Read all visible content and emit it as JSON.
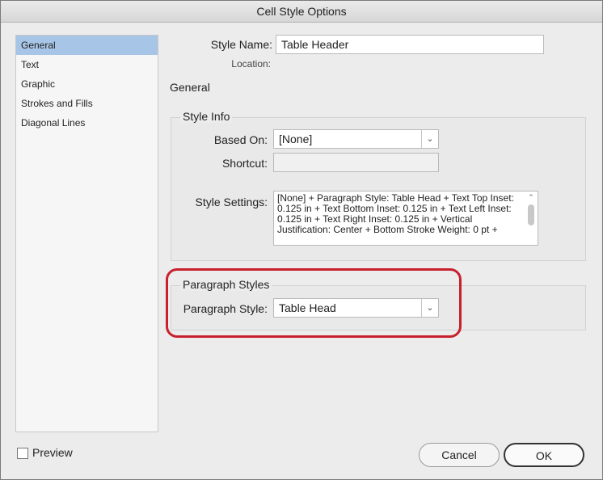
{
  "window": {
    "title": "Cell Style Options"
  },
  "sidebar": {
    "items": [
      {
        "label": "General",
        "selected": true
      },
      {
        "label": "Text",
        "selected": false
      },
      {
        "label": "Graphic",
        "selected": false
      },
      {
        "label": "Strokes and Fills",
        "selected": false
      },
      {
        "label": "Diagonal Lines",
        "selected": false
      }
    ]
  },
  "form": {
    "style_name_label": "Style Name:",
    "style_name_value": "Table Header",
    "location_label": "Location:",
    "section_title": "General"
  },
  "style_info": {
    "title": "Style Info",
    "based_on_label": "Based On:",
    "based_on_value": "[None]",
    "shortcut_label": "Shortcut:",
    "shortcut_value": "",
    "settings_label": "Style Settings:",
    "settings_lines": [
      "[None] + Paragraph Style: Table Head + Text Top Inset:",
      "0.125 in + Text Bottom Inset: 0.125 in + Text Left Inset:",
      "0.125 in + Text Right Inset: 0.125 in + Vertical",
      "Justification: Center + Bottom Stroke Weight: 0 pt +"
    ]
  },
  "paragraph_styles": {
    "title": "Paragraph Styles",
    "label": "Paragraph Style:",
    "value": "Table Head"
  },
  "footer": {
    "preview_label": "Preview",
    "preview_checked": false,
    "cancel_label": "Cancel",
    "ok_label": "OK"
  },
  "colors": {
    "selection": "#a7c5e6",
    "highlight": "#c8202e"
  },
  "icons": {
    "dropdown": "chevron-down-icon",
    "scroll_up": "chevron-up-icon"
  }
}
